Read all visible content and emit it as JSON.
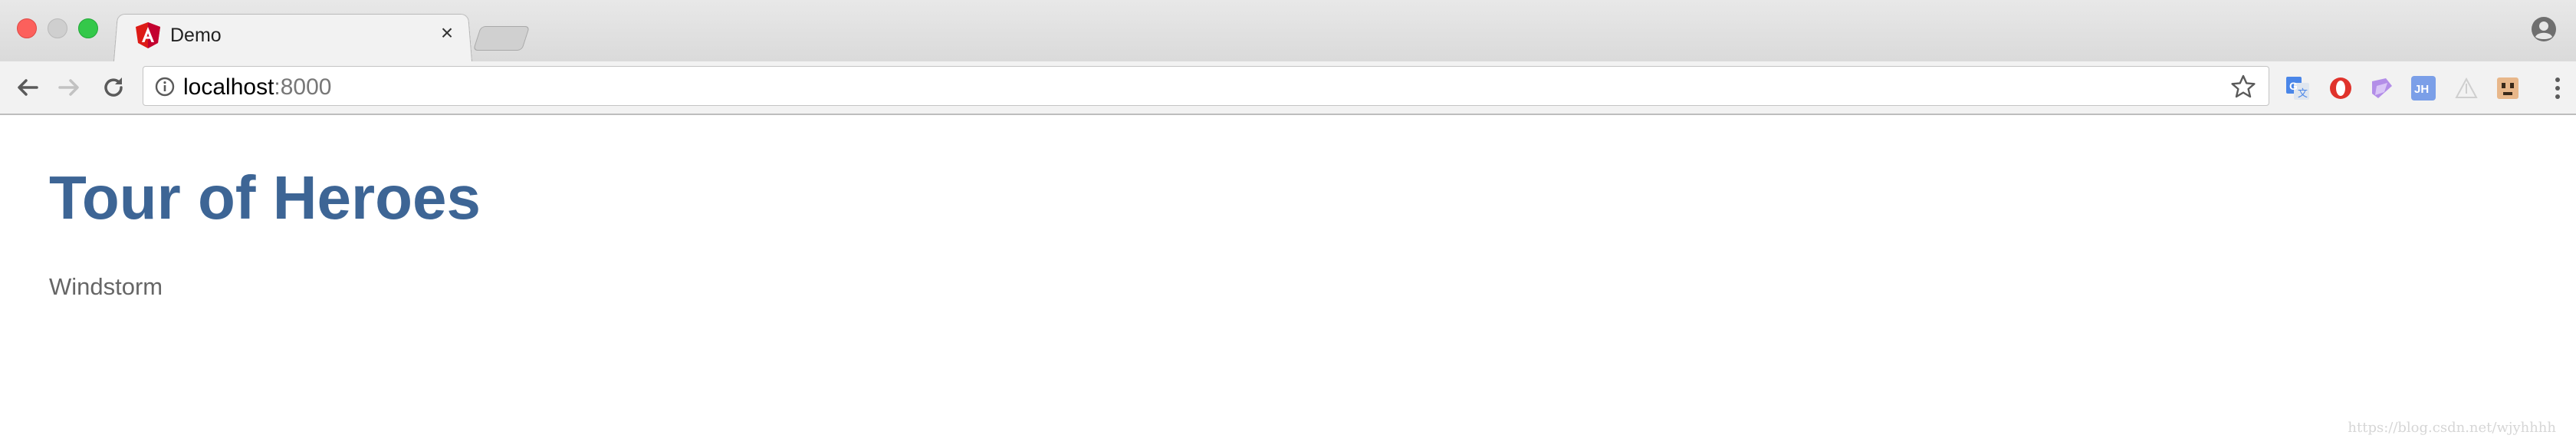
{
  "window": {
    "controls": [
      "close",
      "minimize",
      "maximize"
    ]
  },
  "tab": {
    "title": "Demo",
    "favicon": "angular-logo-icon",
    "close_glyph": "×"
  },
  "toolbar": {
    "back_icon": "back-arrow-icon",
    "forward_icon": "forward-arrow-icon",
    "reload_icon": "reload-icon",
    "url_host": "localhost",
    "url_port": ":8000",
    "extensions": [
      "google-translate-icon",
      "opera-icon",
      "pen-icon",
      "jh-icon",
      "grey-triangle-icon",
      "face-icon"
    ],
    "extension_labels": {
      "jh": "JH"
    }
  },
  "page": {
    "title": "Tour of Heroes",
    "hero_name": "Windstorm"
  },
  "watermark": "https://blog.csdn.net/wjyhhhh"
}
